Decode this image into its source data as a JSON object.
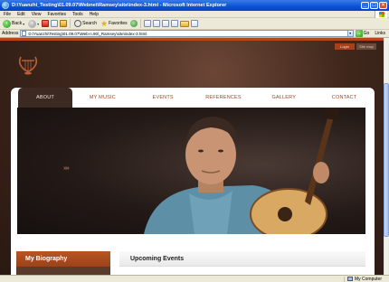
{
  "window": {
    "title": "D:\\Yuanzhi_Testing\\01.09.07\\Webnet\\Ramsey\\site\\index-3.html - Microsoft Internet Explorer"
  },
  "menu": [
    "File",
    "Edit",
    "View",
    "Favorites",
    "Tools",
    "Help"
  ],
  "toolbar": {
    "back": "Back",
    "search": "Search",
    "favorites": "Favorites"
  },
  "address": {
    "label": "Address",
    "value": "D:\\Yuanzhi\\Testing\\01.09.07\\Web-n.90\\_Ramsey\\site\\index-3.html",
    "go": "Go",
    "links": "Links"
  },
  "site": {
    "top_buttons": {
      "login": "Login",
      "sitemap": "Site map"
    },
    "nav": [
      "ABOUT",
      "MY MUSIC",
      "EVENTS",
      "REFERENCES",
      "GALLERY",
      "CONTACT"
    ],
    "hero_arrows": "»»",
    "biography_title": "My Biography",
    "events_title": "Upcoming Events"
  },
  "status": {
    "zone": "My Computer"
  },
  "colors": {
    "accent": "#b7471a",
    "nav_active_bg": "#3c2a22",
    "nav_text": "#a04522",
    "page_bg": "#3e261b"
  }
}
